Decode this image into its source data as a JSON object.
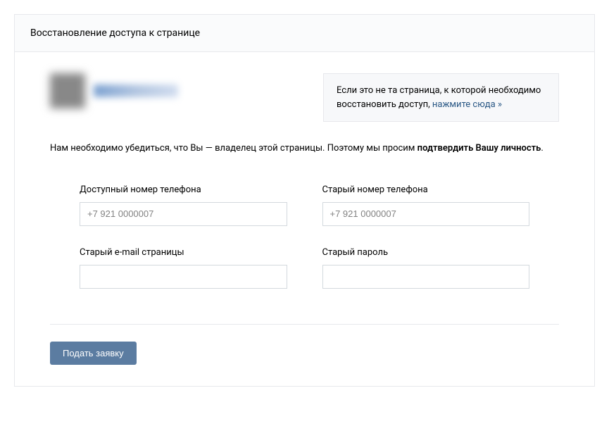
{
  "header": {
    "title": "Восстановление доступа к странице"
  },
  "notice": {
    "text_before": "Если это не та страница, к которой необходимо восстановить доступ, ",
    "link_text": "нажмите сюда »"
  },
  "description": {
    "text_before": "Нам необходимо убедиться, что Вы — владелец этой страницы. Поэтому мы просим ",
    "bold_text": "подтвердить Вашу личность",
    "text_after": "."
  },
  "form": {
    "available_phone": {
      "label": "Доступный номер телефона",
      "placeholder": "+7 921 0000007",
      "value": ""
    },
    "old_phone": {
      "label": "Старый номер телефона",
      "placeholder": "+7 921 0000007",
      "value": ""
    },
    "old_email": {
      "label": "Старый e-mail страницы",
      "placeholder": "",
      "value": ""
    },
    "old_password": {
      "label": "Старый пароль",
      "placeholder": "",
      "value": ""
    }
  },
  "submit": {
    "label": "Подать заявку"
  }
}
